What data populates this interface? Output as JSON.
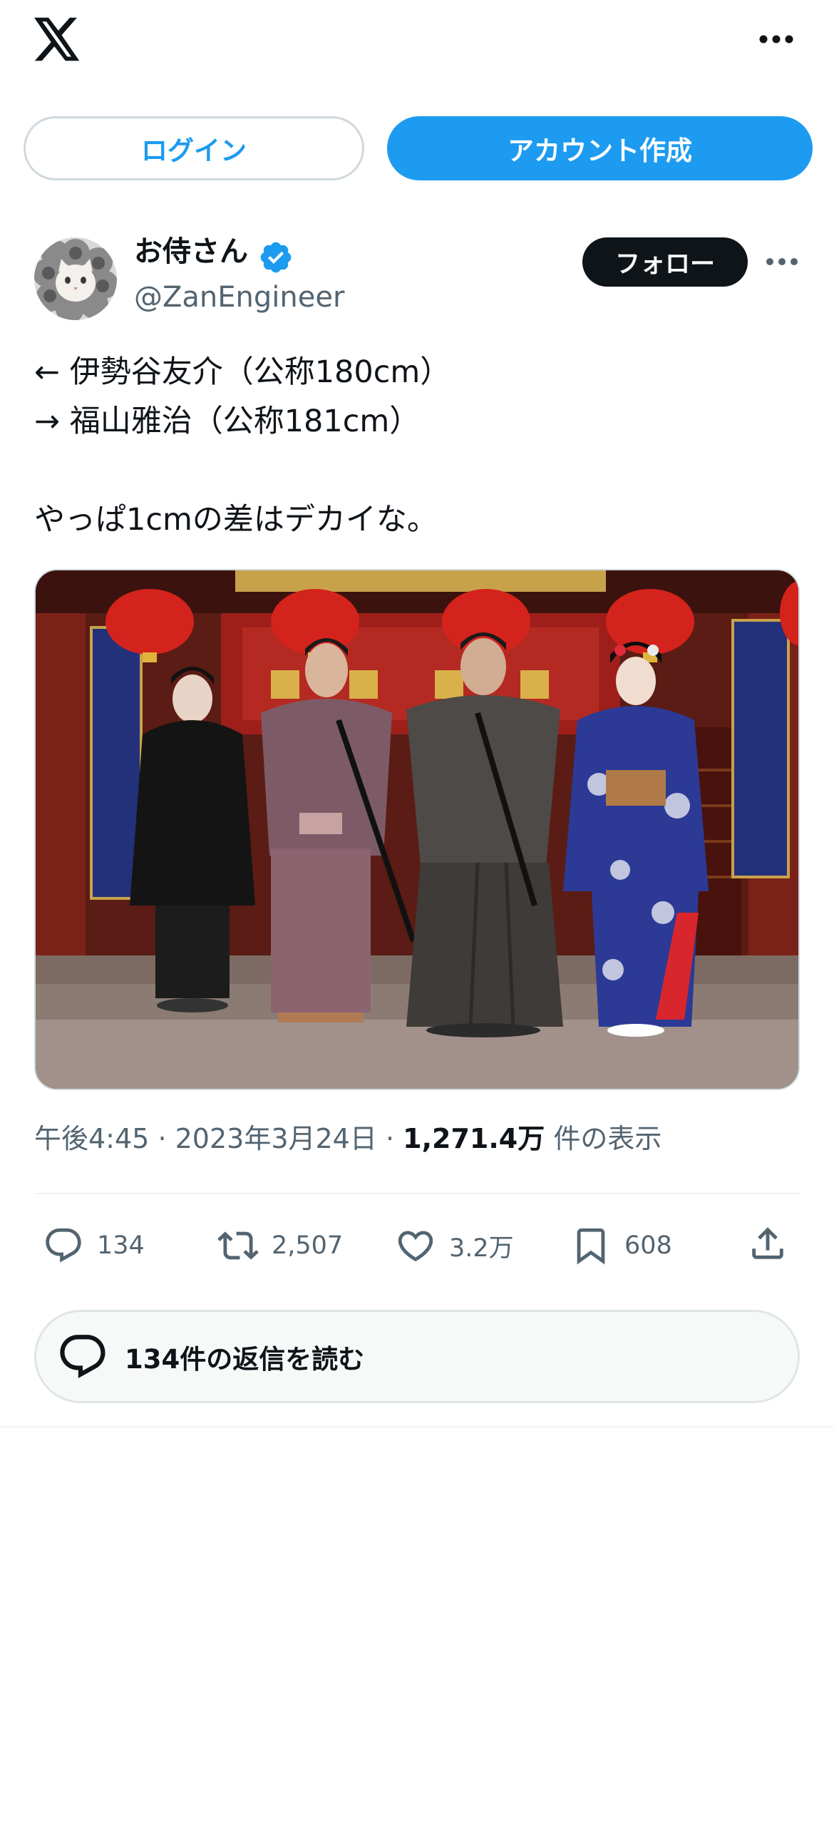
{
  "header": {
    "logo_icon": "x-logo-icon",
    "more_icon": "more-horizontal-icon"
  },
  "auth": {
    "login_label": "ログイン",
    "signup_label": "アカウント作成"
  },
  "author": {
    "name": "お侍さん",
    "handle": "@ZanEngineer",
    "verified": true,
    "follow_label": "フォロー"
  },
  "tweet": {
    "lines": [
      "← 伊勢谷友介（公称180cm）",
      "→ 福山雅治（公称181cm）",
      "",
      "やっぱ1cmの差はデカイな。"
    ]
  },
  "meta": {
    "time": "午後4:45",
    "separator": "·",
    "date": "2023年3月24日",
    "views_count": "1,271.4万",
    "views_label": "件の表示"
  },
  "actions": {
    "replies": "134",
    "retweets": "2,507",
    "likes": "3.2万",
    "bookmarks": "608"
  },
  "replies_button": {
    "label": "134件の返信を読む"
  },
  "colors": {
    "accent": "#1d9bf0",
    "text": "#0f1419",
    "secondary": "#536471",
    "border": "#cfd9de"
  }
}
